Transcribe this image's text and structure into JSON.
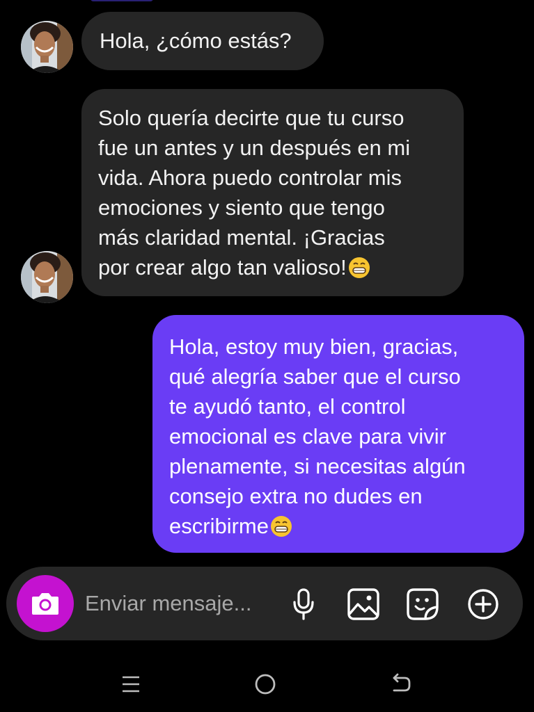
{
  "colors": {
    "background": "#000000",
    "incoming_bubble": "#262626",
    "outgoing_bubble": "#6a3df5",
    "camera_button": "#c412d0",
    "composer": "#262626",
    "placeholder": "#a8a8a8"
  },
  "messages": [
    {
      "direction": "incoming",
      "lines": [
        "Hola, ¿cómo estás?"
      ]
    },
    {
      "direction": "incoming",
      "lines": [
        "Solo quería decirte que tu curso",
        "fue un antes y un después en mi",
        "vida. Ahora puedo controlar mis",
        "emociones y siento que tengo",
        "más claridad mental. ¡Gracias",
        "por crear algo tan valioso!"
      ],
      "emoji": "grinning-face-icon"
    },
    {
      "direction": "outgoing",
      "lines": [
        "Hola, estoy muy bien, gracias,",
        "qué alegría saber que el curso",
        "te ayudó tanto, el control",
        "emocional es clave para vivir",
        "plenamente, si necesitas algún",
        "consejo extra no dudes en",
        "escribirme"
      ],
      "emoji": "grinning-face-icon"
    }
  ],
  "composer": {
    "placeholder": "Enviar mensaje...",
    "icons": [
      "camera-icon",
      "microphone-icon",
      "image-gallery-icon",
      "sticker-icon",
      "plus-circle-icon"
    ]
  },
  "nav_bar": {
    "icons": [
      "recent-apps-icon",
      "home-icon",
      "back-icon"
    ]
  }
}
